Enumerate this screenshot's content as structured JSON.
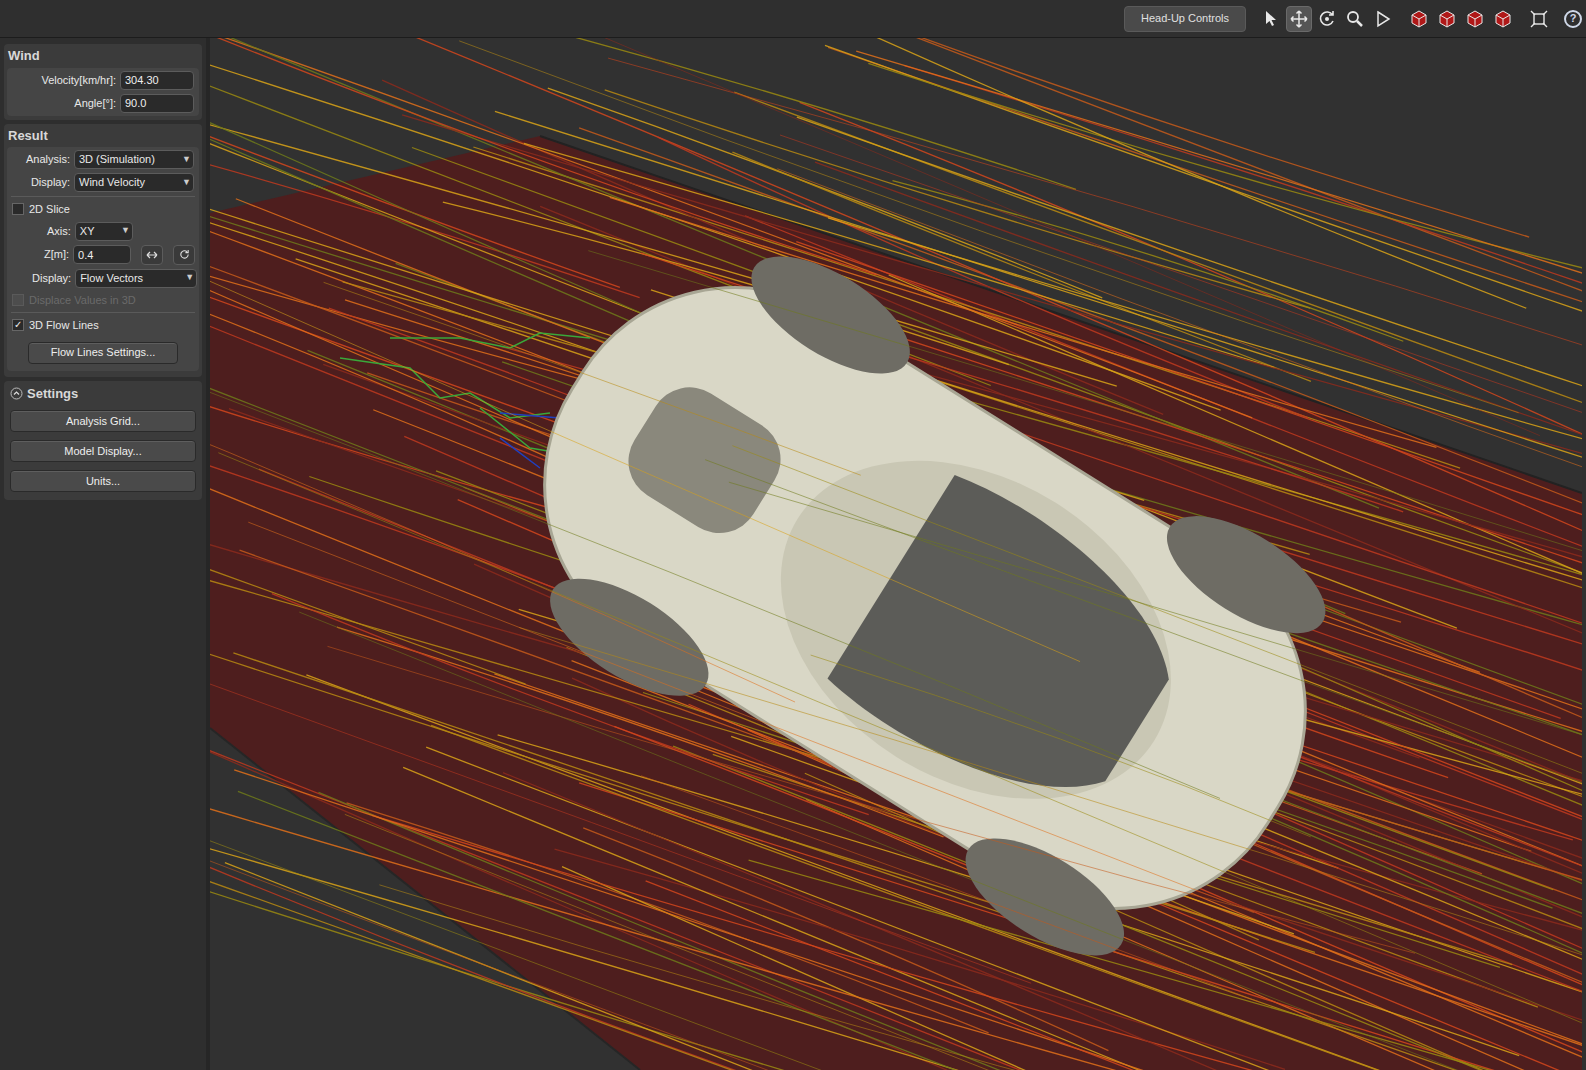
{
  "toolbar": {
    "head_up_button": "Head-Up Controls",
    "help": "?",
    "tools": [
      {
        "kind": "select",
        "selected": false
      },
      {
        "kind": "pan",
        "selected": true
      },
      {
        "kind": "orbit",
        "selected": false
      },
      {
        "kind": "zoom",
        "selected": false
      },
      {
        "kind": "play",
        "selected": false
      },
      {
        "kind": "view",
        "selected": false
      },
      {
        "kind": "view",
        "selected": false
      },
      {
        "kind": "view",
        "selected": false
      },
      {
        "kind": "view",
        "selected": false
      },
      {
        "kind": "fit",
        "selected": false
      }
    ]
  },
  "wind": {
    "title": "Wind",
    "fields": [
      {
        "label": "Velocity[km/hr]:",
        "value": "304.30"
      },
      {
        "label": "Angle[°]:",
        "value": "90.0"
      }
    ]
  },
  "result": {
    "title": "Result",
    "analysis": {
      "label": "Analysis:",
      "value": "3D (Simulation)"
    },
    "display": {
      "label": "Display:",
      "value": "Wind Velocity"
    },
    "slice": {
      "label": "2D Slice",
      "checked": false
    },
    "axis": {
      "label": "Axis:",
      "value": "XY"
    },
    "z": {
      "label": "Z[m]:",
      "value": "0.4"
    },
    "slice_display": {
      "label": "Display:",
      "value": "Flow Vectors"
    },
    "displace": {
      "label": "Displace Values in 3D",
      "checked": false,
      "disabled": true
    },
    "flow_lines": {
      "label": "3D Flow Lines",
      "checked": true
    },
    "flow_settings": "Flow Lines Settings..."
  },
  "settings": {
    "title": "Settings",
    "expanded": true,
    "buttons": [
      "Analysis Grid...",
      "Model Display...",
      "Units..."
    ]
  }
}
